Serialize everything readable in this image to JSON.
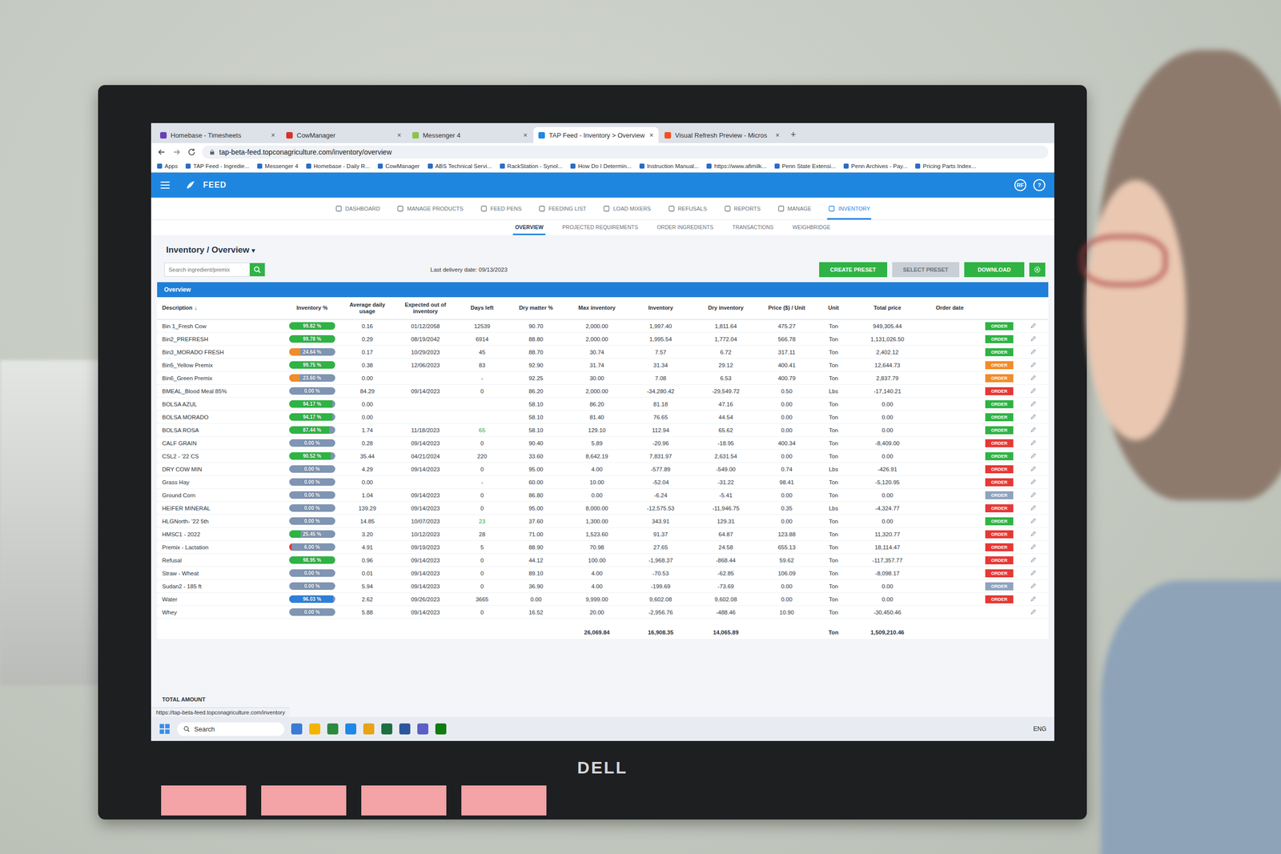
{
  "browser": {
    "tabs": [
      {
        "label": "Homebase - Timesheets",
        "selected": false,
        "color": "#6a3fb5"
      },
      {
        "label": "CowManager",
        "selected": false,
        "color": "#d6322b"
      },
      {
        "label": "Messenger 4",
        "selected": false,
        "color": "#8bc34a"
      },
      {
        "label": "TAP Feed - Inventory > Overview",
        "selected": true,
        "color": "#1e88e5"
      },
      {
        "label": "Visual Refresh Preview - Micros",
        "selected": false,
        "color": "#f25022"
      }
    ],
    "tab_close": "×",
    "new_tab": "+",
    "url": "tap-beta-feed.topconagriculture.com/inventory/overview",
    "bookmarks": [
      "Apps",
      "TAP Feed - Ingredie...",
      "Messenger 4",
      "Homebase - Daily R...",
      "CowManager",
      "ABS Technical Servi...",
      "RackStation - Synol...",
      "How Do I Determin...",
      "Instruction Manual...",
      "https://www.afimilk...",
      "Penn State Extensi...",
      "Penn Archives - Pay...",
      "Pricing Parts Index..."
    ]
  },
  "app": {
    "brand": "FEED",
    "avatar": "RF",
    "help": "?",
    "nav": [
      {
        "label": "DASHBOARD",
        "selected": false
      },
      {
        "label": "MANAGE PRODUCTS",
        "selected": false
      },
      {
        "label": "FEED PENS",
        "selected": false
      },
      {
        "label": "FEEDING LIST",
        "selected": false
      },
      {
        "label": "LOAD MIXERS",
        "selected": false
      },
      {
        "label": "REFUSALS",
        "selected": false
      },
      {
        "label": "REPORTS",
        "selected": false
      },
      {
        "label": "MANAGE",
        "selected": false
      },
      {
        "label": "INVENTORY",
        "selected": true
      }
    ],
    "subtabs": [
      {
        "label": "OVERVIEW",
        "selected": true
      },
      {
        "label": "PROJECTED REQUIREMENTS",
        "selected": false
      },
      {
        "label": "ORDER INGREDIENTS",
        "selected": false
      },
      {
        "label": "TRANSACTIONS",
        "selected": false
      },
      {
        "label": "WEIGHBRIDGE",
        "selected": false
      }
    ],
    "title": "Inventory / Overview",
    "title_caret": "▾",
    "search": {
      "placeholder": "Search ingredient/premix"
    },
    "last_delivery": "Last delivery date: 09/13/2023",
    "buttons": [
      {
        "label": "CREATE PRESET",
        "disabled": false
      },
      {
        "label": "SELECT PRESET",
        "disabled": true
      },
      {
        "label": "DOWNLOAD",
        "disabled": false
      }
    ],
    "panel_title": "Overview"
  },
  "table": {
    "columns": [
      "Description",
      "Inventory %",
      "Average daily usage",
      "Expected out of inventory",
      "Days left",
      "Dry matter %",
      "Max inventory",
      "Inventory",
      "Dry inventory",
      "Price ($) / Unit",
      "Unit",
      "Total price",
      "Order date"
    ],
    "sort_icon": "↓",
    "rows": [
      {
        "description": "Bin 1_Fresh Cow",
        "inventory_pct": "99.82 %",
        "level": 0.9982,
        "bar_color": "#2fb344",
        "avg_daily_usage": "0.16",
        "expected_out": "01/12/2058",
        "days_left": "12539",
        "days_highlight": false,
        "dry_matter": "90.70",
        "max_inventory": "2,000.00",
        "inventory": "1,997.40",
        "dry_inventory": "1,811.64",
        "price_unit": "475.27",
        "unit": "Ton",
        "total_price": "949,305.44",
        "order": {
          "label": "ORDER",
          "color": "#2fb344"
        }
      },
      {
        "description": "Bin2_PREFRESH",
        "inventory_pct": "99.78 %",
        "level": 0.9978,
        "bar_color": "#2fb344",
        "avg_daily_usage": "0.29",
        "expected_out": "08/19/2042",
        "days_left": "6914",
        "days_highlight": false,
        "dry_matter": "88.80",
        "max_inventory": "2,000.00",
        "inventory": "1,995.54",
        "dry_inventory": "1,772.04",
        "price_unit": "566.78",
        "unit": "Ton",
        "total_price": "1,131,026.50",
        "order": {
          "label": "ORDER",
          "color": "#2fb344"
        }
      },
      {
        "description": "Bin3_MORADO FRESH",
        "inventory_pct": "24.64 %",
        "level": 0.2464,
        "bar_color": "#f08c2a",
        "avg_daily_usage": "0.17",
        "expected_out": "10/29/2023",
        "days_left": "45",
        "days_highlight": false,
        "dry_matter": "88.70",
        "max_inventory": "30.74",
        "inventory": "7.57",
        "dry_inventory": "6.72",
        "price_unit": "317.11",
        "unit": "Ton",
        "total_price": "2,402.12",
        "order": {
          "label": "ORDER",
          "color": "#2fb344"
        }
      },
      {
        "description": "Bin5_Yellow Premix",
        "inventory_pct": "99.75 %",
        "level": 0.9975,
        "bar_color": "#2fb344",
        "avg_daily_usage": "0.38",
        "expected_out": "12/06/2023",
        "days_left": "83",
        "days_highlight": false,
        "dry_matter": "92.90",
        "max_inventory": "31.74",
        "inventory": "31.34",
        "dry_inventory": "29.12",
        "price_unit": "400.41",
        "unit": "Ton",
        "total_price": "12,644.73",
        "order": {
          "label": "ORDER",
          "color": "#f08c2a"
        }
      },
      {
        "description": "Bin6_Green Premix",
        "inventory_pct": "23.60 %",
        "level": 0.236,
        "bar_color": "#f08c2a",
        "avg_daily_usage": "0.00",
        "expected_out": "",
        "days_left": "-",
        "days_highlight": false,
        "dry_matter": "92.25",
        "max_inventory": "30.00",
        "inventory": "7.08",
        "dry_inventory": "6.53",
        "price_unit": "400.79",
        "unit": "Ton",
        "total_price": "2,837.79",
        "order": {
          "label": "ORDER",
          "color": "#f08c2a"
        }
      },
      {
        "description": "BMEAL_Blood Meal 85%",
        "inventory_pct": "0.00 %",
        "level": 0,
        "bar_color": "#e53935",
        "avg_daily_usage": "84.29",
        "expected_out": "09/14/2023",
        "days_left": "0",
        "days_highlight": false,
        "dry_matter": "86.20",
        "max_inventory": "2,000.00",
        "inventory": "-34,280.42",
        "dry_inventory": "-29,549.72",
        "price_unit": "0.50",
        "unit": "Lbs",
        "total_price": "-17,140.21",
        "order": {
          "label": "ORDER",
          "color": "#e53935"
        }
      },
      {
        "description": "BOLSA AZUL",
        "inventory_pct": "94.17 %",
        "level": 0.9417,
        "bar_color": "#2fb344",
        "avg_daily_usage": "0.00",
        "expected_out": "",
        "days_left": "",
        "days_highlight": false,
        "dry_matter": "58.10",
        "max_inventory": "86.20",
        "inventory": "81.18",
        "dry_inventory": "47.16",
        "price_unit": "0.00",
        "unit": "Ton",
        "total_price": "0.00",
        "order": {
          "label": "ORDER",
          "color": "#2fb344"
        }
      },
      {
        "description": "BOLSA MORADO",
        "inventory_pct": "94.17 %",
        "level": 0.9417,
        "bar_color": "#2fb344",
        "avg_daily_usage": "0.00",
        "expected_out": "",
        "days_left": "",
        "days_highlight": false,
        "dry_matter": "58.10",
        "max_inventory": "81.40",
        "inventory": "76.65",
        "dry_inventory": "44.54",
        "price_unit": "0.00",
        "unit": "Ton",
        "total_price": "0.00",
        "order": {
          "label": "ORDER",
          "color": "#2fb344"
        }
      },
      {
        "description": "BOLSA ROSA",
        "inventory_pct": "87.44 %",
        "level": 0.8744,
        "bar_color": "#2fb344",
        "avg_daily_usage": "1.74",
        "expected_out": "11/18/2023",
        "days_left": "65",
        "days_highlight": true,
        "dry_matter": "58.10",
        "max_inventory": "129.10",
        "inventory": "112.94",
        "dry_inventory": "65.62",
        "price_unit": "0.00",
        "unit": "Ton",
        "total_price": "0.00",
        "order": {
          "label": "ORDER",
          "color": "#2fb344"
        }
      },
      {
        "description": "CALF GRAIN",
        "inventory_pct": "0.00 %",
        "level": 0,
        "bar_color": "#e53935",
        "avg_daily_usage": "0.28",
        "expected_out": "09/14/2023",
        "days_left": "0",
        "days_highlight": false,
        "dry_matter": "90.40",
        "max_inventory": "5.89",
        "inventory": "-20.96",
        "dry_inventory": "-18.95",
        "price_unit": "400.34",
        "unit": "Ton",
        "total_price": "-8,409.00",
        "order": {
          "label": "ORDER",
          "color": "#e53935"
        }
      },
      {
        "description": "CSL2 - '22 CS",
        "inventory_pct": "90.52 %",
        "level": 0.9052,
        "bar_color": "#2fb344",
        "avg_daily_usage": "35.44",
        "expected_out": "04/21/2024",
        "days_left": "220",
        "days_highlight": false,
        "dry_matter": "33.60",
        "max_inventory": "8,642.19",
        "inventory": "7,831.97",
        "dry_inventory": "2,631.54",
        "price_unit": "0.00",
        "unit": "Ton",
        "total_price": "0.00",
        "order": {
          "label": "ORDER",
          "color": "#2fb344"
        }
      },
      {
        "description": "DRY COW MIN",
        "inventory_pct": "0.00 %",
        "level": 0,
        "bar_color": "#e53935",
        "avg_daily_usage": "4.29",
        "expected_out": "09/14/2023",
        "days_left": "0",
        "days_highlight": false,
        "dry_matter": "95.00",
        "max_inventory": "4.00",
        "inventory": "-577.89",
        "dry_inventory": "-549.00",
        "price_unit": "0.74",
        "unit": "Lbs",
        "total_price": "-426.91",
        "order": {
          "label": "ORDER",
          "color": "#e53935"
        }
      },
      {
        "description": "Grass Hay",
        "inventory_pct": "0.00 %",
        "level": 0,
        "bar_color": "#e53935",
        "avg_daily_usage": "0.00",
        "expected_out": "",
        "days_left": "-",
        "days_highlight": false,
        "dry_matter": "60.00",
        "max_inventory": "10.00",
        "inventory": "-52.04",
        "dry_inventory": "-31.22",
        "price_unit": "98.41",
        "unit": "Ton",
        "total_price": "-5,120.95",
        "order": {
          "label": "ORDER",
          "color": "#e53935"
        }
      },
      {
        "description": "Ground Corn",
        "inventory_pct": "0.00 %",
        "level": 0,
        "bar_color": "#e53935",
        "avg_daily_usage": "1.04",
        "expected_out": "09/14/2023",
        "days_left": "0",
        "days_highlight": false,
        "dry_matter": "86.80",
        "max_inventory": "0.00",
        "inventory": "-6.24",
        "dry_inventory": "-5.41",
        "price_unit": "0.00",
        "unit": "Ton",
        "total_price": "0.00",
        "order": {
          "label": "ORDER",
          "color": "#8fa3bf"
        }
      },
      {
        "description": "HEIFER MINERAL",
        "inventory_pct": "0.00 %",
        "level": 0,
        "bar_color": "#e53935",
        "avg_daily_usage": "139.29",
        "expected_out": "09/14/2023",
        "days_left": "0",
        "days_highlight": false,
        "dry_matter": "95.00",
        "max_inventory": "8,000.00",
        "inventory": "-12,575.53",
        "dry_inventory": "-11,946.75",
        "price_unit": "0.35",
        "unit": "Lbs",
        "total_price": "-4,324.77",
        "order": {
          "label": "ORDER",
          "color": "#e53935"
        }
      },
      {
        "description": "HLGNorth- '22 5th",
        "inventory_pct": "0.00 %",
        "level": 0,
        "bar_color": "#e53935",
        "avg_daily_usage": "14.85",
        "expected_out": "10/07/2023",
        "days_left": "23",
        "days_highlight": true,
        "dry_matter": "37.60",
        "max_inventory": "1,300.00",
        "inventory": "343.91",
        "dry_inventory": "129.31",
        "price_unit": "0.00",
        "unit": "Ton",
        "total_price": "0.00",
        "order": {
          "label": "ORDER",
          "color": "#2fb344"
        }
      },
      {
        "description": "HMSC1 - 2022",
        "inventory_pct": "25.45 %",
        "level": 0.2545,
        "bar_color": "#2fb344",
        "avg_daily_usage": "3.20",
        "expected_out": "10/12/2023",
        "days_left": "28",
        "days_highlight": false,
        "dry_matter": "71.00",
        "max_inventory": "1,523.60",
        "inventory": "91.37",
        "dry_inventory": "64.87",
        "price_unit": "123.88",
        "unit": "Ton",
        "total_price": "11,320.77",
        "order": {
          "label": "ORDER",
          "color": "#e53935"
        }
      },
      {
        "description": "Premix - Lactation",
        "inventory_pct": "6.00 %",
        "level": 0.06,
        "bar_color": "#e53935",
        "avg_daily_usage": "4.91",
        "expected_out": "09/19/2023",
        "days_left": "5",
        "days_highlight": false,
        "dry_matter": "88.90",
        "max_inventory": "70.98",
        "inventory": "27.65",
        "dry_inventory": "24.58",
        "price_unit": "655.13",
        "unit": "Ton",
        "total_price": "18,114.47",
        "order": {
          "label": "ORDER",
          "color": "#e53935"
        }
      },
      {
        "description": "Refusal",
        "inventory_pct": "98.95 %",
        "level": 0.9895,
        "bar_color": "#2fb344",
        "avg_daily_usage": "0.96",
        "expected_out": "09/14/2023",
        "days_left": "0",
        "days_highlight": false,
        "dry_matter": "44.12",
        "max_inventory": "100.00",
        "inventory": "-1,968.37",
        "dry_inventory": "-868.44",
        "price_unit": "59.62",
        "unit": "Ton",
        "total_price": "-117,357.77",
        "order": {
          "label": "ORDER",
          "color": "#e53935"
        }
      },
      {
        "description": "Straw - Wheat",
        "inventory_pct": "0.00 %",
        "level": 0,
        "bar_color": "#e53935",
        "avg_daily_usage": "0.01",
        "expected_out": "09/14/2023",
        "days_left": "0",
        "days_highlight": false,
        "dry_matter": "89.10",
        "max_inventory": "4.00",
        "inventory": "-70.53",
        "dry_inventory": "-62.85",
        "price_unit": "106.09",
        "unit": "Ton",
        "total_price": "-8,098.17",
        "order": {
          "label": "ORDER",
          "color": "#e53935"
        }
      },
      {
        "description": "Sudan2 - 185 ft",
        "inventory_pct": "0.00 %",
        "level": 0,
        "bar_color": "#e53935",
        "avg_daily_usage": "5.94",
        "expected_out": "09/14/2023",
        "days_left": "0",
        "days_highlight": false,
        "dry_matter": "36.90",
        "max_inventory": "4.00",
        "inventory": "-199.69",
        "dry_inventory": "-73.69",
        "price_unit": "0.00",
        "unit": "Ton",
        "total_price": "0.00",
        "order": {
          "label": "ORDER",
          "color": "#8fa3bf"
        }
      },
      {
        "description": "Water",
        "inventory_pct": "96.03 %",
        "level": 0.9603,
        "bar_color": "#2f7fd8",
        "avg_daily_usage": "2.62",
        "expected_out": "09/26/2023",
        "days_left": "3665",
        "days_highlight": false,
        "dry_matter": "0.00",
        "max_inventory": "9,999.00",
        "inventory": "9,602.08",
        "dry_inventory": "9,602.08",
        "price_unit": "0.00",
        "unit": "Ton",
        "total_price": "0.00",
        "order": {
          "label": "ORDER",
          "color": "#e53935"
        }
      },
      {
        "description": "Whey",
        "inventory_pct": "0.00 %",
        "level": 0,
        "bar_color": "#e53935",
        "avg_daily_usage": "5.88",
        "expected_out": "09/14/2023",
        "days_left": "0",
        "days_highlight": false,
        "dry_matter": "16.52",
        "max_inventory": "20.00",
        "inventory": "-2,956.76",
        "dry_inventory": "-488.46",
        "price_unit": "10.90",
        "unit": "Ton",
        "total_price": "-30,450.46",
        "order": null
      }
    ],
    "totals": {
      "max_inventory": "26,069.84",
      "inventory": "16,908.35",
      "dry_inventory": "14,065.89",
      "unit": "Ton",
      "total_price": "1,509,210.46"
    },
    "total_label": "TOTAL AMOUNT"
  },
  "status_url": "https://tap-beta-feed.topconagriculture.com/inventory",
  "taskbar": {
    "search": "Search",
    "tray": "ENG"
  },
  "monitor": {
    "brand": "DELL"
  }
}
